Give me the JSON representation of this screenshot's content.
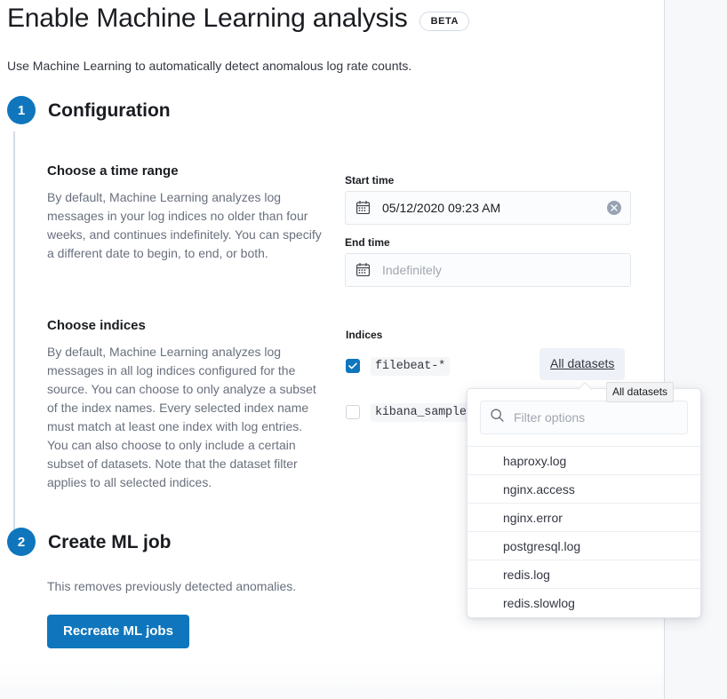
{
  "header": {
    "title": "Enable Machine Learning analysis",
    "badge": "BETA",
    "subtitle": "Use Machine Learning to automatically detect anomalous log rate counts."
  },
  "steps": [
    {
      "number": "1",
      "title": "Configuration"
    },
    {
      "number": "2",
      "title": "Create ML job"
    }
  ],
  "time_range": {
    "heading": "Choose a time range",
    "body": "By default, Machine Learning analyzes log messages in your log indices no older than four weeks, and continues indefinitely. You can specify a different date to begin, to end, or both.",
    "start_label": "Start time",
    "start_value": "05/12/2020 09:23 AM",
    "end_label": "End time",
    "end_placeholder": "Indefinitely",
    "calendar_icon": "calendar-icon",
    "clear_icon": "clear-circle-icon"
  },
  "indices": {
    "heading": "Choose indices",
    "body": "By default, Machine Learning analyzes log messages in all log indices configured for the source. You can choose to only analyze a subset of the index names. Every selected index name must match at least one index with log entries. You can also choose to only include a certain subset of datasets. Note that the dataset filter applies to all selected indices.",
    "label": "Indices",
    "items": [
      {
        "name": "filebeat-*",
        "checked": true
      },
      {
        "name": "kibana_sample.",
        "checked": false
      }
    ]
  },
  "datasets": {
    "button_label": "All datasets",
    "tooltip": "All datasets",
    "search_placeholder": "Filter options",
    "search_icon": "search-icon",
    "options": [
      "haproxy.log",
      "nginx.access",
      "nginx.error",
      "postgresql.log",
      "redis.log",
      "redis.slowlog"
    ]
  },
  "create_job": {
    "body": "This removes previously detected anomalies.",
    "button_label": "Recreate ML jobs"
  },
  "colors": {
    "accent": "#0f76bd",
    "text": "#1a1c21",
    "muted": "#69707d"
  }
}
